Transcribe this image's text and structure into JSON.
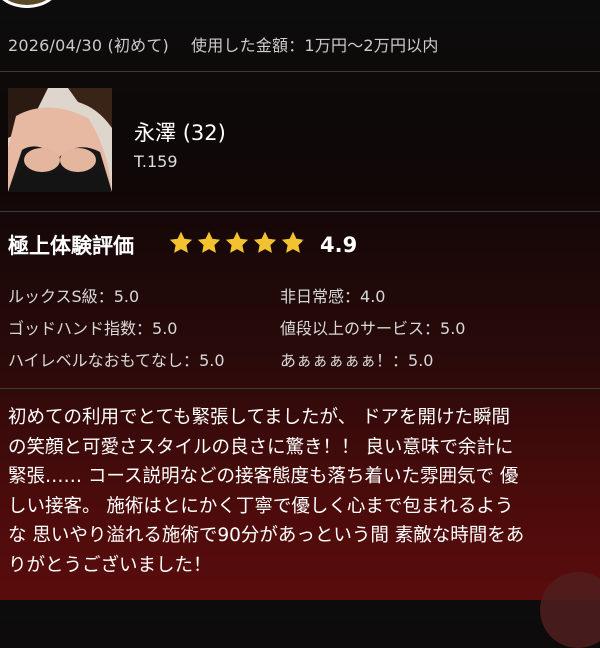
{
  "review": {
    "date": "2026/04/30",
    "visit_type": "(初めて)",
    "amount_label": "使用した金額：",
    "amount_value": "1万円〜2万円以内"
  },
  "staff": {
    "name": "永澤",
    "age": "(32)",
    "height": "T.159"
  },
  "rating": {
    "title": "極上体験評価",
    "score": "4.9",
    "score_value": 4.9,
    "max": 5,
    "star_color": "#f2c230",
    "star_empty_color": "#666666",
    "items": [
      {
        "label": "ルックスS級",
        "value": "5.0"
      },
      {
        "label": "非日常感",
        "value": "4.0"
      },
      {
        "label": "ゴッドハンド指数",
        "value": "5.0"
      },
      {
        "label": "値段以上のサービス",
        "value": "5.0"
      },
      {
        "label": "ハイレベルなおもてなし",
        "value": "5.0"
      },
      {
        "label": "あぁぁぁぁぁ！",
        "value": "5.0"
      }
    ]
  },
  "review_body": [
    "初めての利用でとても緊張してましたが、 ドアを開けた瞬間",
    "の笑顔と可愛さスタイルの良さに驚き！！ 良い意味で余計に",
    "緊張…… コース説明などの接客態度も落ち着いた雰囲気で 優",
    "しい接客。 施術はとにかく丁寧で優しく心まで包まれるよう",
    "な 思いやり溢れる施術で90分があっという間 素敵な時間をあ",
    "りがとうございました！"
  ]
}
